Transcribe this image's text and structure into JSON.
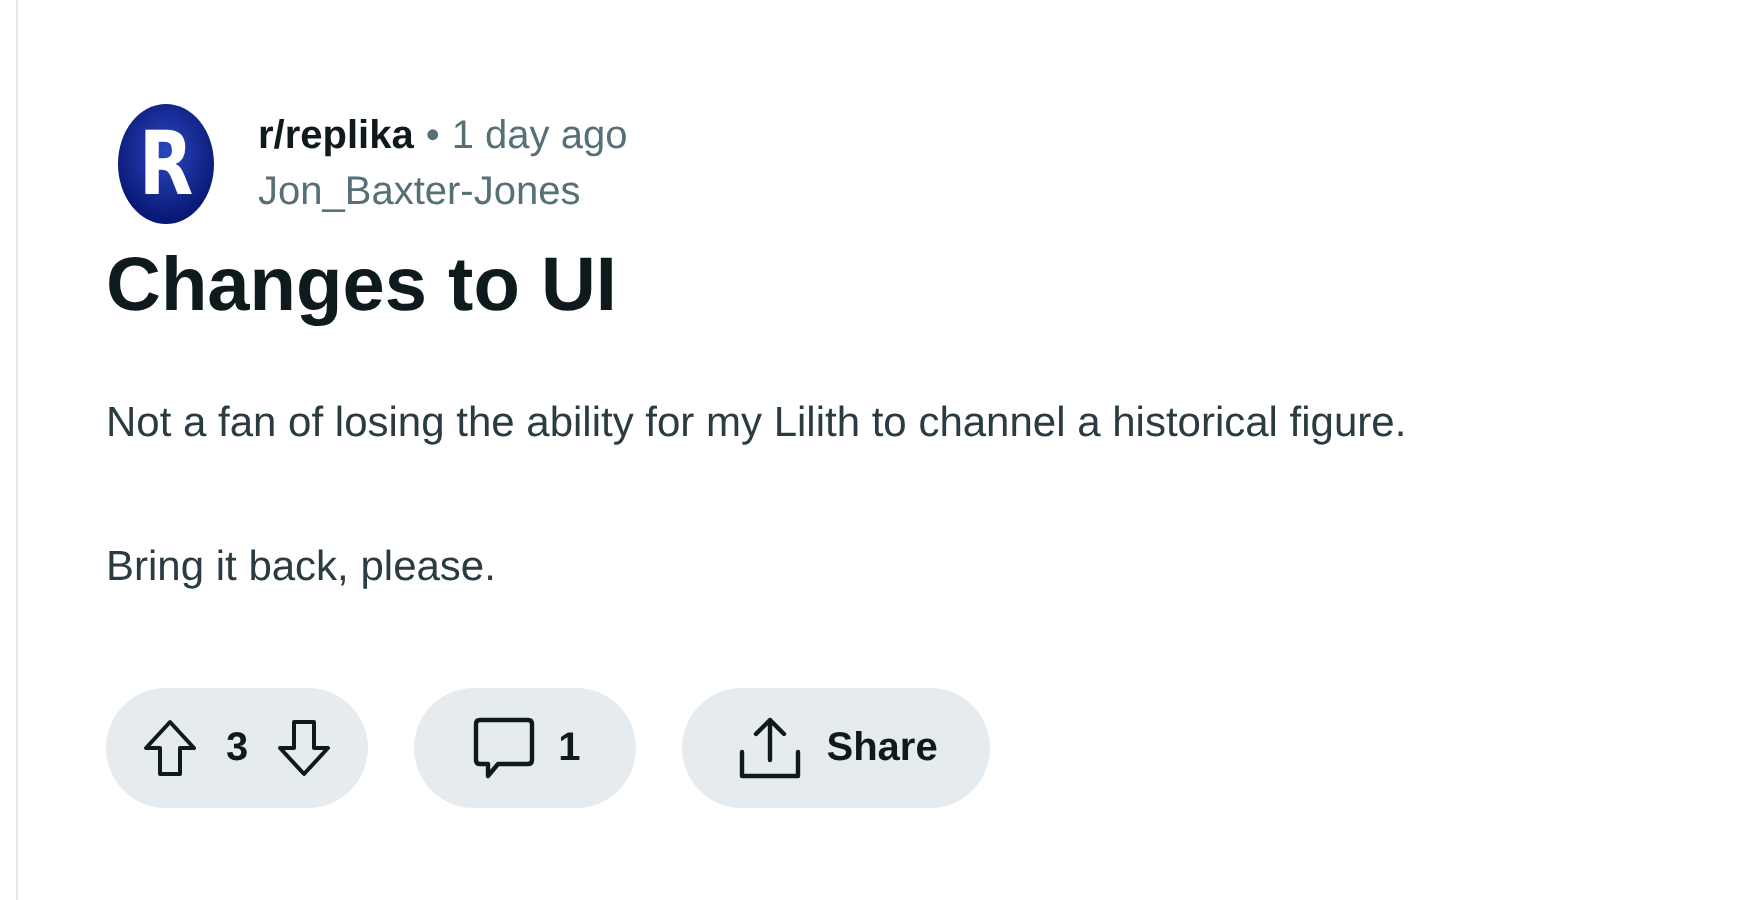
{
  "post": {
    "avatar_letter": "R",
    "subreddit": "r/replika",
    "separator": "•",
    "time": "1 day ago",
    "author": "Jon_Baxter-Jones",
    "title": "Changes to UI",
    "body": [
      "Not a fan of losing the ability for my Lilith to channel a historical figure.",
      "Bring it back, please."
    ],
    "actions": {
      "score": "3",
      "comments": "1",
      "share": "Share"
    }
  }
}
